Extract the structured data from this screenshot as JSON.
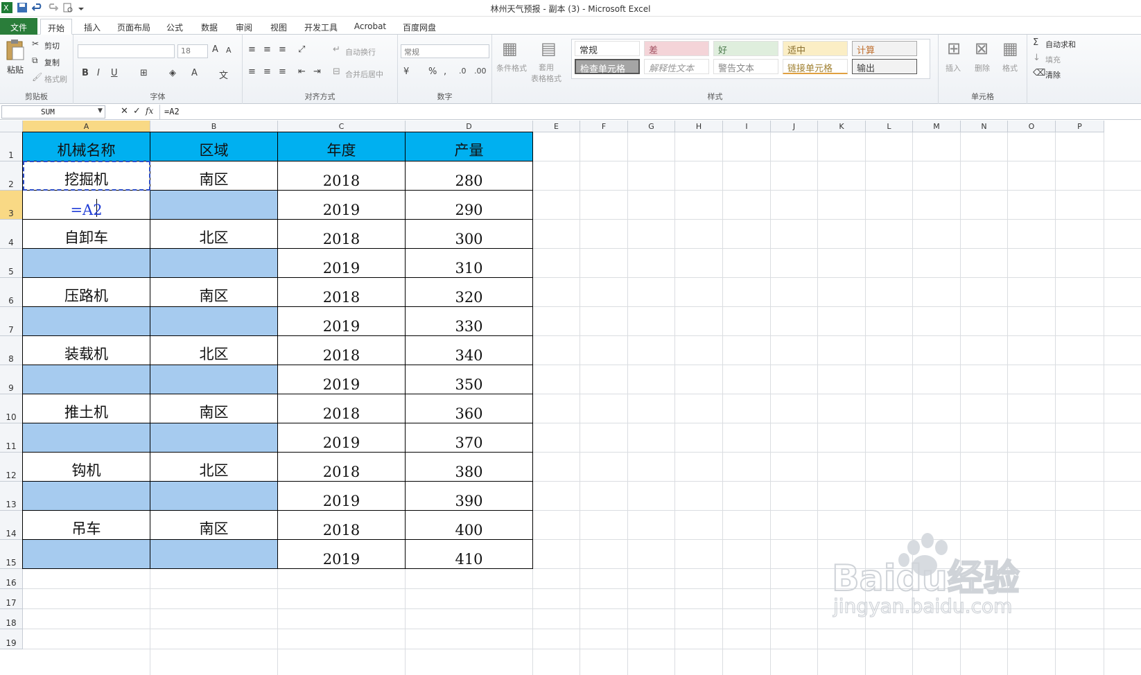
{
  "window": {
    "title": "林州天气预报 - 副本 (3)  -  Microsoft Excel"
  },
  "tabs": [
    "文件",
    "开始",
    "插入",
    "页面布局",
    "公式",
    "数据",
    "审阅",
    "视图",
    "开发工具",
    "Acrobat",
    "百度网盘"
  ],
  "ribbon": {
    "clipboard": {
      "paste": "粘贴",
      "cut": "剪切",
      "copy": "复制",
      "format_painter": "格式刷",
      "label": "剪贴板"
    },
    "font": {
      "font_size": "18",
      "label": "字体"
    },
    "alignment": {
      "wrap": "自动换行",
      "merge": "合并后居中",
      "label": "对齐方式"
    },
    "number": {
      "format": "常规",
      "label": "数字"
    },
    "styles": {
      "conditional": "条件格式",
      "table_format": "套用\n表格格式",
      "cells": [
        "常规",
        "差",
        "好",
        "适中",
        "计算",
        "检查单元格",
        "解释性文本",
        "警告文本",
        "链接单元格",
        "输出"
      ],
      "label": "样式"
    },
    "cells_group": {
      "insert": "插入",
      "delete": "删除",
      "format": "格式",
      "label": "单元格"
    },
    "editing": {
      "autosum": "自动求和",
      "fill": "填充",
      "clear": "清除"
    }
  },
  "formula_bar": {
    "name_box": "SUM",
    "formula": "=A2"
  },
  "columns": [
    "A",
    "B",
    "C",
    "D",
    "E",
    "F",
    "G",
    "H",
    "I",
    "J",
    "K",
    "L",
    "M",
    "N",
    "O",
    "P"
  ],
  "rows": [
    "1",
    "2",
    "3",
    "4",
    "5",
    "6",
    "7",
    "8",
    "9",
    "10",
    "11",
    "12",
    "13",
    "14",
    "15",
    "16",
    "17",
    "18",
    "19"
  ],
  "table": {
    "headers": [
      "机械名称",
      "区域",
      "年度",
      "产量"
    ],
    "rows": [
      [
        "挖掘机",
        "南区",
        "2018",
        "280"
      ],
      [
        "=A2",
        "",
        "2019",
        "290"
      ],
      [
        "自卸车",
        "北区",
        "2018",
        "300"
      ],
      [
        "",
        "",
        "2019",
        "310"
      ],
      [
        "压路机",
        "南区",
        "2018",
        "320"
      ],
      [
        "",
        "",
        "2019",
        "330"
      ],
      [
        "装载机",
        "北区",
        "2018",
        "340"
      ],
      [
        "",
        "",
        "2019",
        "350"
      ],
      [
        "推土机",
        "南区",
        "2018",
        "360"
      ],
      [
        "",
        "",
        "2019",
        "370"
      ],
      [
        "钩机",
        "北区",
        "2018",
        "380"
      ],
      [
        "",
        "",
        "2019",
        "390"
      ],
      [
        "吊车",
        "南区",
        "2018",
        "400"
      ],
      [
        "",
        "",
        "2019",
        "410"
      ]
    ]
  },
  "watermark": {
    "brand": "Baidu经验",
    "url": "jingyan.baidu.com"
  },
  "colors": {
    "header_fill": "#00b0f0",
    "blank_fill": "#a6cbef",
    "selected_header": "#f9d985",
    "file_tab": "#2a7d3a"
  }
}
